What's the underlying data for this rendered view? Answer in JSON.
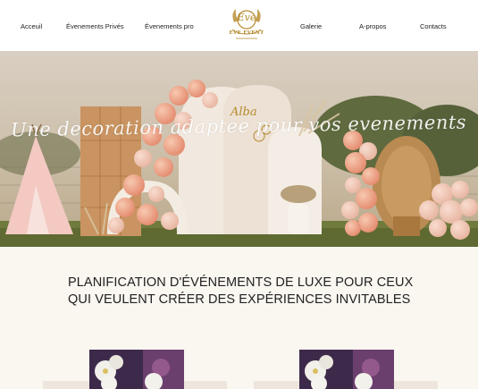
{
  "nav": {
    "left_links": [
      "Acceuil",
      "Évenements Privés",
      "Évenements pro"
    ],
    "right_links": [
      "Galerie",
      "A-propos",
      "Contacts"
    ],
    "logo": {
      "script": "Eve",
      "brand": "EVE EVENT"
    }
  },
  "hero": {
    "tagline": "Une decoration adaptee pour vos evenements",
    "sign_text": "Alba"
  },
  "section": {
    "headline_line1": "PLANIFICATION D'ÉVÉNEMENTS DE LUXE POUR CEUX",
    "headline_line2": "QUI VEULENT CRÉER DES EXPÉRIENCES INVITABLES"
  },
  "colors": {
    "accent_gold": "#b58a2c",
    "page_bg": "#faf6f0",
    "text": "#222222"
  }
}
